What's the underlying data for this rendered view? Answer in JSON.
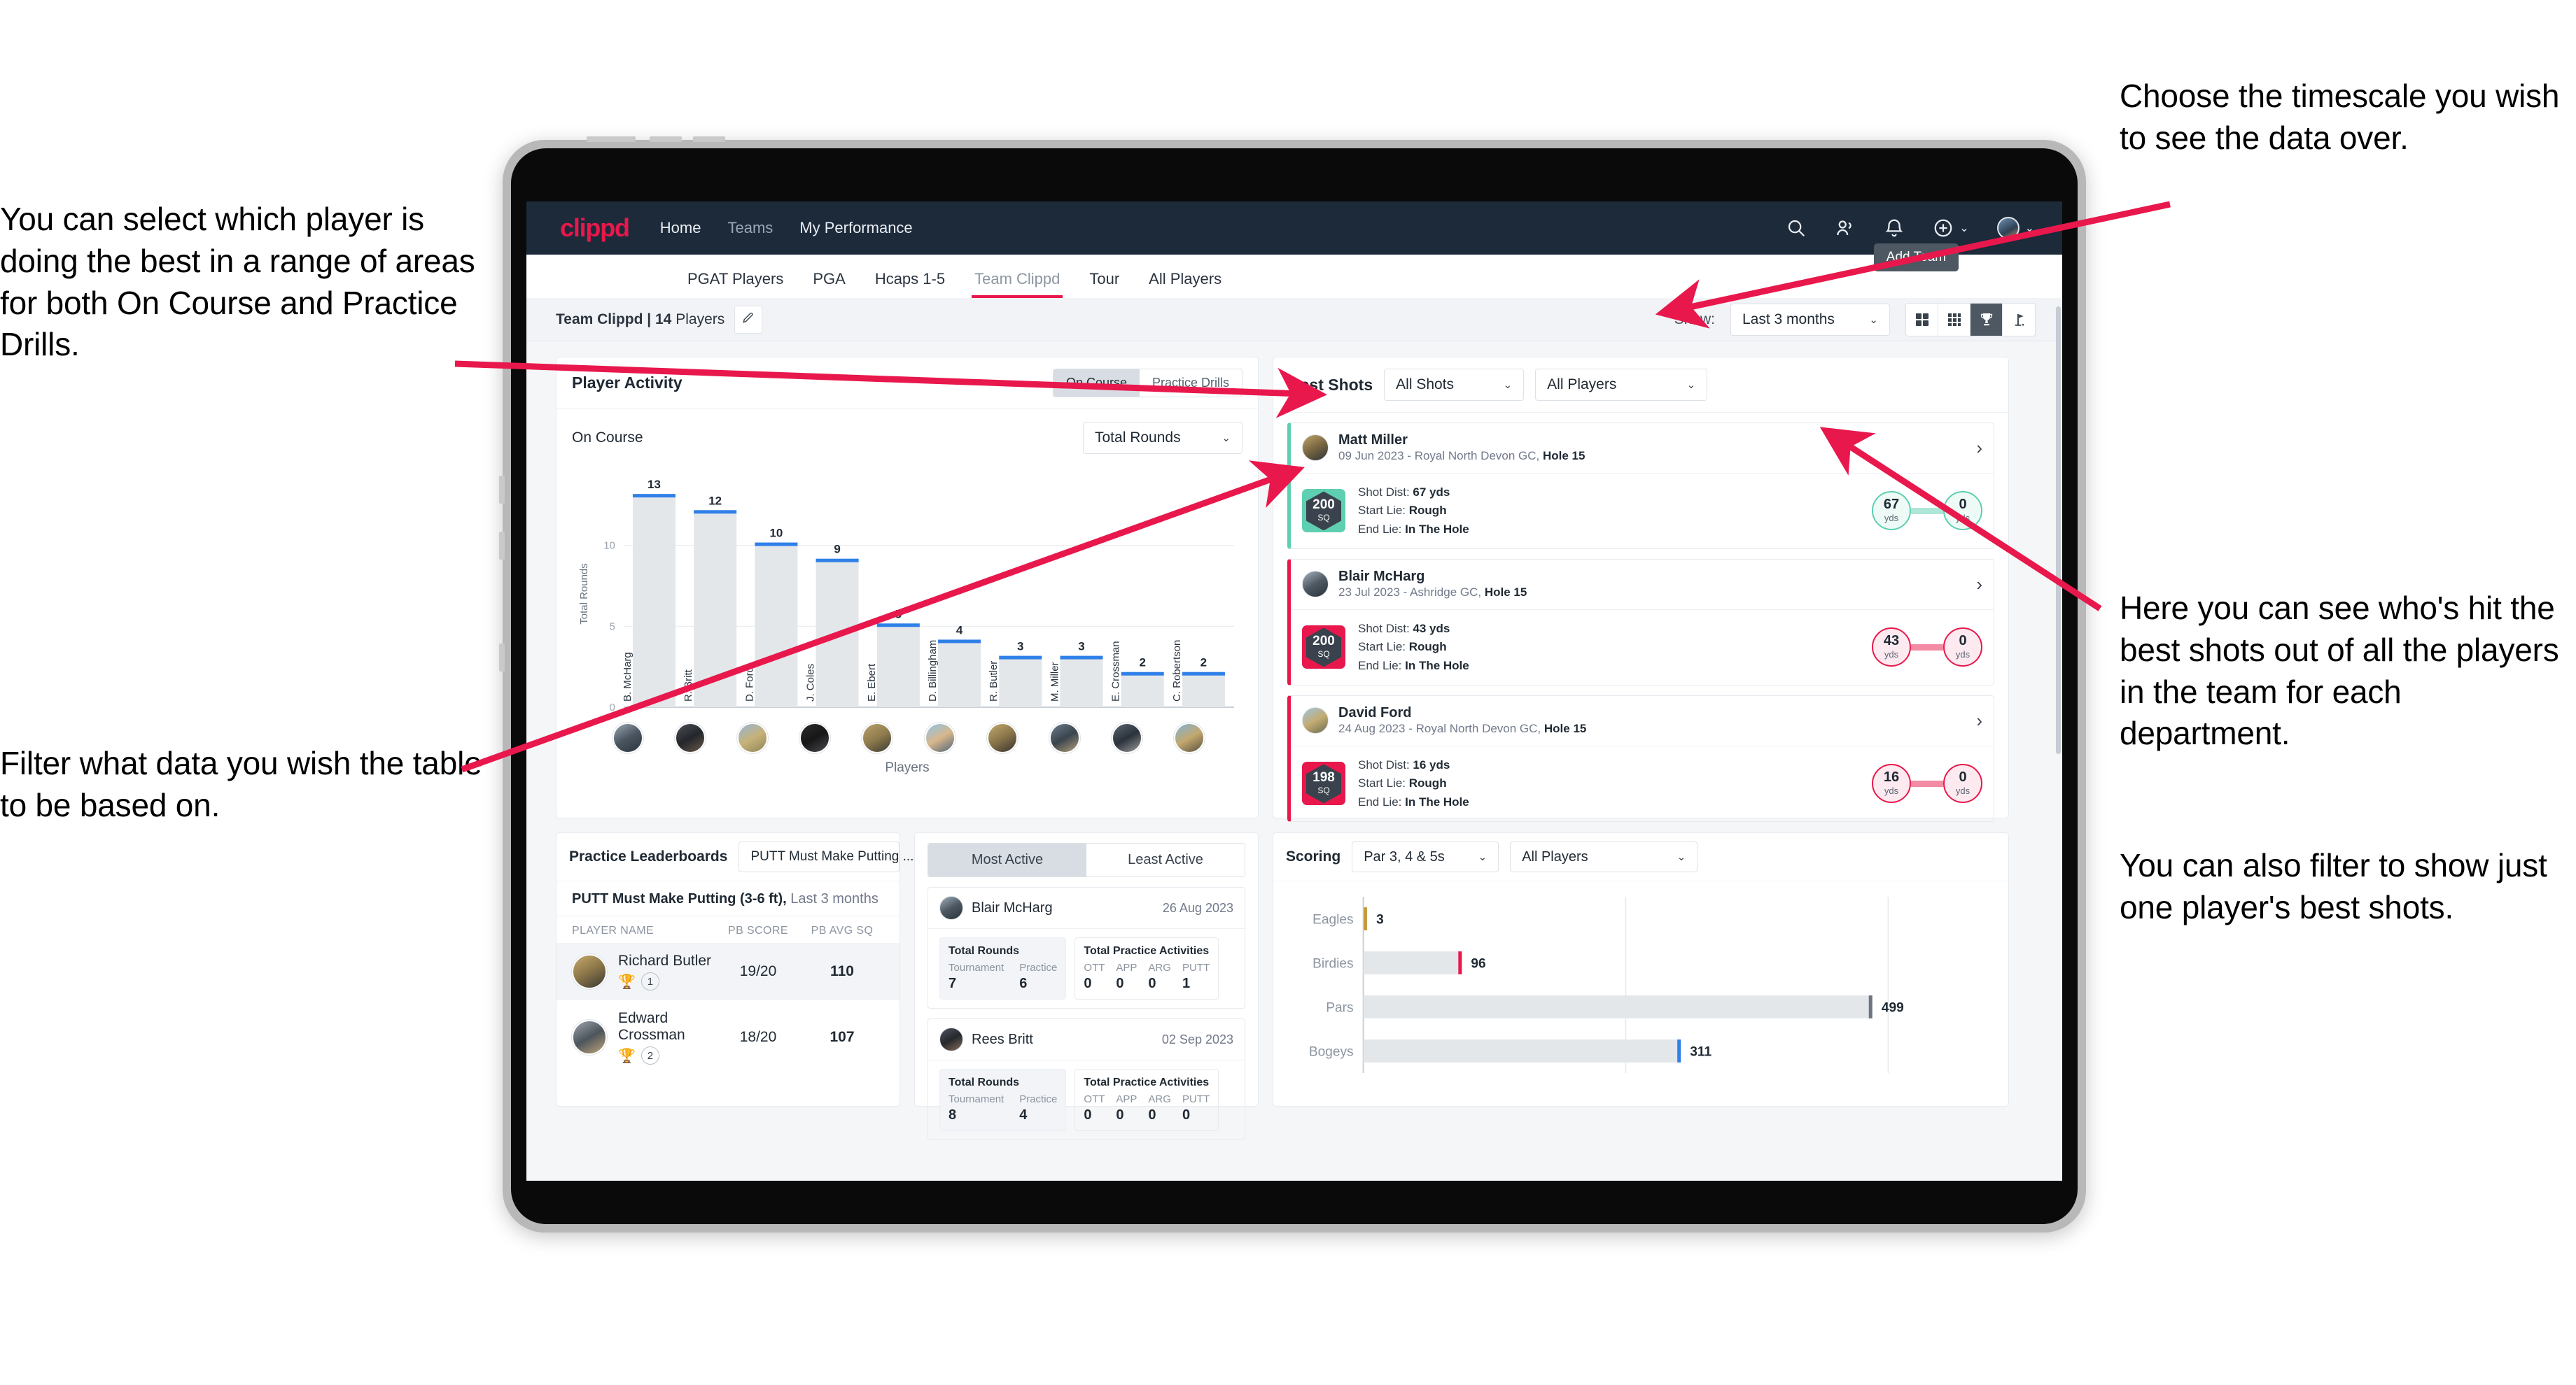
{
  "annotations": {
    "left_top": "You can select which player is doing the best in a range of areas for both On Course and Practice Drills.",
    "left_bottom": "Filter what data you wish the table to be based on.",
    "right_top": "Choose the timescale you wish to see the data over.",
    "right_middle": "Here you can see who's hit the best shots out of all the players in the team for each department.",
    "right_bottom": "You can also filter to show just one player's best shots."
  },
  "app": {
    "logo": "clippd",
    "nav": [
      {
        "label": "Home",
        "active": true
      },
      {
        "label": "Teams",
        "active": false
      },
      {
        "label": "My Performance",
        "active": true
      }
    ],
    "header_icons": [
      "search-icon",
      "people-icon",
      "bell-icon",
      "plus-circle-icon",
      "avatar-icon"
    ],
    "tooltip": "Add Team"
  },
  "tabs": [
    {
      "label": "PGAT Players",
      "active": false
    },
    {
      "label": "PGA",
      "active": false
    },
    {
      "label": "Hcaps 1-5",
      "active": false
    },
    {
      "label": "Team Clippd",
      "active": true
    },
    {
      "label": "Tour",
      "active": false
    },
    {
      "label": "All Players",
      "active": false
    }
  ],
  "subbar": {
    "team_name": "Team Clippd",
    "team_count": "| 14",
    "team_players_word": "Players",
    "edit_icon": "pencil-icon",
    "show_label": "Show:",
    "timescale": "Last 3 months",
    "view_buttons": [
      "grid-large-icon",
      "grid-small-icon",
      "trophy-icon",
      "flag-icon"
    ],
    "active_view": "trophy-icon"
  },
  "player_activity": {
    "title": "Player Activity",
    "segments": [
      {
        "label": "On Course",
        "active": true
      },
      {
        "label": "Practice Drills",
        "active": false
      }
    ],
    "sub_label": "On Course",
    "metric_select": "Total Rounds",
    "chart_data": {
      "type": "bar",
      "title": "Player Activity - On Course",
      "xlabel": "Players",
      "ylabel": "Total Rounds",
      "ylim": [
        0,
        14
      ],
      "yticks": [
        0,
        5,
        10
      ],
      "grid": true,
      "categories": [
        "B. McHarg",
        "R. Britt",
        "D. Ford",
        "J. Coles",
        "E. Ebert",
        "D. Billingham",
        "R. Butler",
        "M. Miller",
        "E. Crossman",
        "C. Robertson"
      ],
      "values": [
        13,
        12,
        10,
        9,
        5,
        4,
        3,
        3,
        2,
        2
      ],
      "bar_color": "#e4e7ea",
      "cap_color": "#2f80e8"
    }
  },
  "best_shots": {
    "title": "Best Shots",
    "shot_filter": "All Shots",
    "player_filter": "All Players",
    "cards": [
      {
        "name": "Matt Miller",
        "meta_date": "09 Jun 2023 - Royal North Devon GC, ",
        "meta_hole": "Hole 15",
        "score": "200",
        "score_unit": "SQ",
        "accent": "#5ecfb1",
        "shot_dist_label": "Shot Dist: ",
        "shot_dist": "67 yds",
        "start_lie_label": "Start Lie: ",
        "start_lie": "Rough",
        "end_lie_label": "End Lie: ",
        "end_lie": "In The Hole",
        "from_value": "67",
        "from_unit": "yds",
        "to_value": "0",
        "to_unit": "yds"
      },
      {
        "name": "Blair McHarg",
        "meta_date": "23 Jul 2023 - Ashridge GC, ",
        "meta_hole": "Hole 15",
        "score": "200",
        "score_unit": "SQ",
        "accent": "#e8184c",
        "shot_dist_label": "Shot Dist: ",
        "shot_dist": "43 yds",
        "start_lie_label": "Start Lie: ",
        "start_lie": "Rough",
        "end_lie_label": "End Lie: ",
        "end_lie": "In The Hole",
        "from_value": "43",
        "from_unit": "yds",
        "to_value": "0",
        "to_unit": "yds"
      },
      {
        "name": "David Ford",
        "meta_date": "24 Aug 2023 - Royal North Devon GC, ",
        "meta_hole": "Hole 15",
        "score": "198",
        "score_unit": "SQ",
        "accent": "#e8184c",
        "shot_dist_label": "Shot Dist: ",
        "shot_dist": "16 yds",
        "start_lie_label": "Start Lie: ",
        "start_lie": "Rough",
        "end_lie_label": "End Lie: ",
        "end_lie": "In The Hole",
        "from_value": "16",
        "from_unit": "yds",
        "to_value": "0",
        "to_unit": "yds"
      }
    ]
  },
  "practice_leaderboards": {
    "title": "Practice Leaderboards",
    "drill_select": "PUTT Must Make Putting ...",
    "subtitle_bold": "PUTT Must Make Putting (3-6 ft),",
    "subtitle_rest": " Last 3 months",
    "columns": [
      "PLAYER NAME",
      "PB SCORE",
      "PB AVG SQ"
    ],
    "rows": [
      {
        "name": "Richard Butler",
        "rank": "1",
        "trophy": "gold",
        "pb_score": "19/20",
        "pb_avg_sq": "110"
      },
      {
        "name": "Edward Crossman",
        "rank": "2",
        "trophy": "silver",
        "pb_score": "18/20",
        "pb_avg_sq": "107"
      }
    ]
  },
  "activity_panel": {
    "tabs": [
      {
        "label": "Most Active",
        "active": true
      },
      {
        "label": "Least Active",
        "active": false
      }
    ],
    "cards": [
      {
        "name": "Blair McHarg",
        "date": "26 Aug 2023",
        "rounds_title": "Total Rounds",
        "rounds": [
          {
            "key": "Tournament",
            "value": "7"
          },
          {
            "key": "Practice",
            "value": "6"
          }
        ],
        "practice_title": "Total Practice Activities",
        "practice": [
          {
            "key": "OTT",
            "value": "0"
          },
          {
            "key": "APP",
            "value": "0"
          },
          {
            "key": "ARG",
            "value": "0"
          },
          {
            "key": "PUTT",
            "value": "1"
          }
        ]
      },
      {
        "name": "Rees Britt",
        "date": "02 Sep 2023",
        "rounds_title": "Total Rounds",
        "rounds": [
          {
            "key": "Tournament",
            "value": "8"
          },
          {
            "key": "Practice",
            "value": "4"
          }
        ],
        "practice_title": "Total Practice Activities",
        "practice": [
          {
            "key": "OTT",
            "value": "0"
          },
          {
            "key": "APP",
            "value": "0"
          },
          {
            "key": "ARG",
            "value": "0"
          },
          {
            "key": "PUTT",
            "value": "0"
          }
        ]
      }
    ]
  },
  "scoring": {
    "title": "Scoring",
    "par_filter": "Par 3, 4 & 5s",
    "player_filter": "All Players",
    "chart_data": {
      "type": "bar",
      "orientation": "horizontal",
      "title": "Scoring",
      "categories": [
        "Eagles",
        "Birdies",
        "Pars",
        "Bogeys"
      ],
      "values": [
        3,
        96,
        499,
        311
      ],
      "xlim": [
        0,
        560
      ],
      "grid": true,
      "cap_colors": [
        "#c49a3f",
        "#e8184c",
        "#6b7480",
        "#2f80e8"
      ],
      "bar_color": "#e4e7ea"
    }
  }
}
